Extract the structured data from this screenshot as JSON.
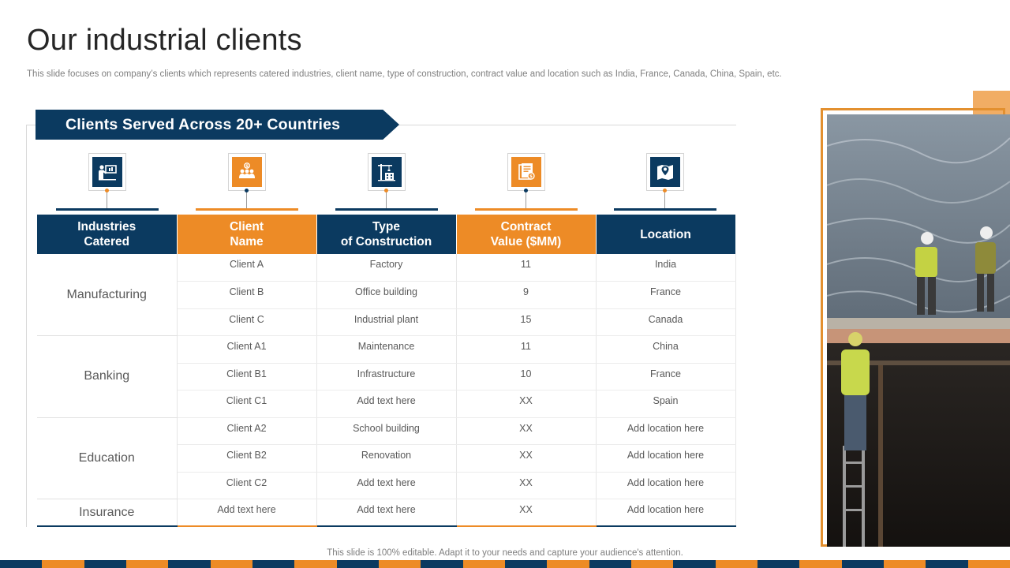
{
  "page": {
    "title": "Our industrial clients",
    "subtitle": "This slide focuses on company’s clients which represents catered industries, client name, type of construction, contract value and location such as India, France, Canada, China, Spain, etc.",
    "footer": "This slide is 100% editable. Adapt it to your needs and capture your audience's attention."
  },
  "banner": {
    "label": "Clients Served Across 20+ Countries"
  },
  "icons": [
    {
      "name": "presentation-icon",
      "color": "#0b3a60"
    },
    {
      "name": "team-icon",
      "color": "#ed8b26"
    },
    {
      "name": "crane-building-icon",
      "color": "#0b3a60"
    },
    {
      "name": "contract-document-icon",
      "color": "#ed8b26"
    },
    {
      "name": "map-pin-icon",
      "color": "#0b3a60"
    }
  ],
  "table": {
    "headers": [
      {
        "line1": "Industries",
        "line2": "Catered"
      },
      {
        "line1": "Client",
        "line2": "Name"
      },
      {
        "line1": "Type",
        "line2": "of Construction"
      },
      {
        "line1": "Contract",
        "line2": "Value ($MM)"
      },
      {
        "line1": "Location",
        "line2": ""
      }
    ],
    "groups": [
      {
        "industry": "Manufacturing",
        "rows": [
          {
            "client": "Client A",
            "type": "Factory",
            "value": "11",
            "location": "India"
          },
          {
            "client": "Client B",
            "type": "Office building",
            "value": "9",
            "location": "France"
          },
          {
            "client": "Client C",
            "type": "Industrial plant",
            "value": "15",
            "location": "Canada"
          }
        ]
      },
      {
        "industry": "Banking",
        "rows": [
          {
            "client": "Client A1",
            "type": "Maintenance",
            "value": "11",
            "location": "China"
          },
          {
            "client": "Client B1",
            "type": "Infrastructure",
            "value": "10",
            "location": "France"
          },
          {
            "client": "Client C1",
            "type": "Add text here",
            "value": "XX",
            "location": "Spain"
          }
        ]
      },
      {
        "industry": "Education",
        "rows": [
          {
            "client": "Client A2",
            "type": "School building",
            "value": "XX",
            "location": "Add location here"
          },
          {
            "client": "Client B2",
            "type": "Renovation",
            "value": "XX",
            "location": "Add location here"
          },
          {
            "client": "Client C2",
            "type": "Add text here",
            "value": "XX",
            "location": "Add location here"
          }
        ]
      },
      {
        "industry": "Insurance",
        "rows": [
          {
            "client": "Add text here",
            "type": "Add text here",
            "value": "XX",
            "location": "Add location here"
          }
        ]
      }
    ]
  },
  "colors": {
    "navy": "#0b3a60",
    "orange": "#ed8b26",
    "frame": "#e3902f"
  }
}
